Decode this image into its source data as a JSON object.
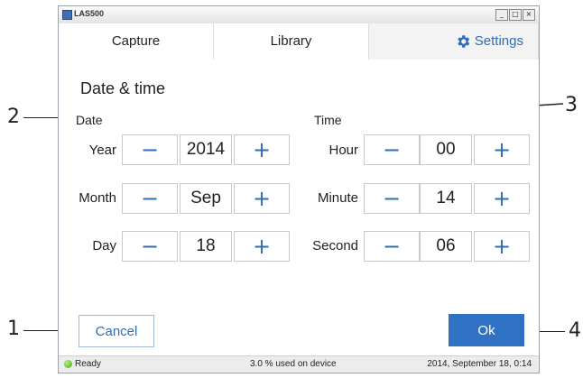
{
  "window": {
    "title": "LAS500",
    "controls": [
      "_",
      "□",
      "×"
    ]
  },
  "tabs": [
    {
      "label": "Capture"
    },
    {
      "label": "Library"
    },
    {
      "label": "Settings",
      "icon": "gear-icon"
    }
  ],
  "page": {
    "title": "Date & time"
  },
  "date": {
    "label": "Date",
    "rows": [
      {
        "label": "Year",
        "value": "2014"
      },
      {
        "label": "Month",
        "value": "Sep"
      },
      {
        "label": "Day",
        "value": "18"
      }
    ]
  },
  "time": {
    "label": "Time",
    "rows": [
      {
        "label": "Hour",
        "value": "00"
      },
      {
        "label": "Minute",
        "value": "14"
      },
      {
        "label": "Second",
        "value": "06"
      }
    ]
  },
  "stepper": {
    "minus": "−",
    "plus": "+"
  },
  "actions": {
    "cancel": "Cancel",
    "ok": "Ok"
  },
  "status": {
    "ready": "Ready",
    "usage": "3.0 % used on device",
    "datetime": "2014, September 18, 0:14"
  },
  "callouts": [
    "1",
    "2",
    "3",
    "4"
  ],
  "colors": {
    "accent": "#2f72c4",
    "link": "#2f6db5",
    "ready": "#3ea81d"
  }
}
